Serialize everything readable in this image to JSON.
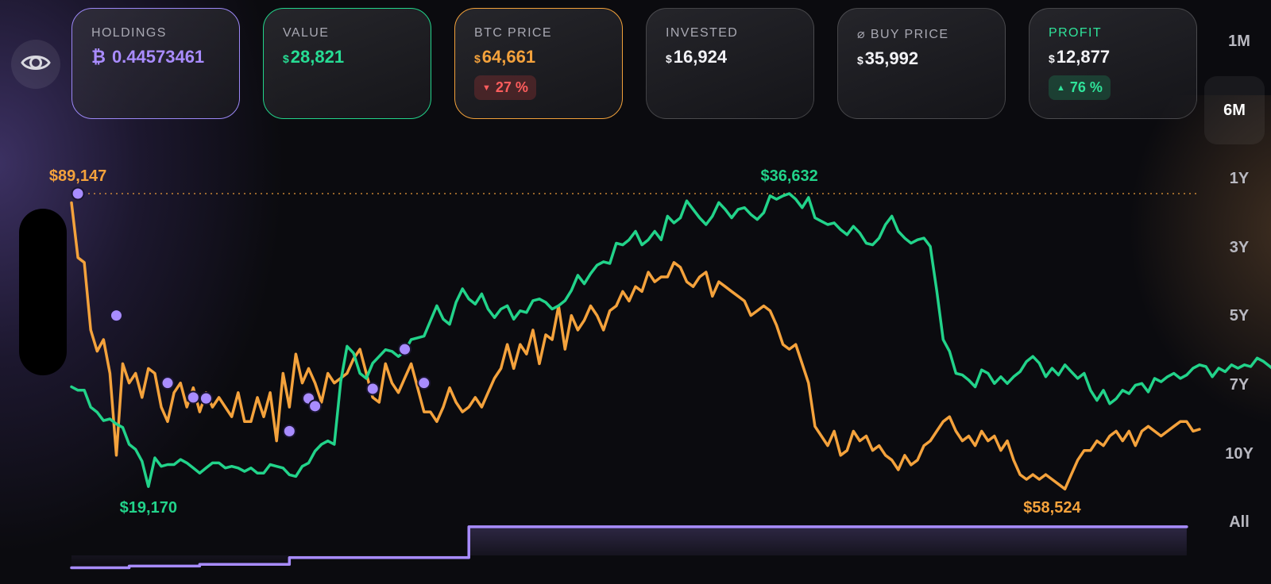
{
  "cards": [
    {
      "label": "HOLDINGS",
      "prefix": "₿",
      "value": "0.44573461",
      "border": "#9b87f5",
      "label_color": "#a8a8b2",
      "value_color": "#a98cff",
      "badge": null
    },
    {
      "label": "VALUE",
      "prefix": "$",
      "value": "28,821",
      "border": "#22d38a",
      "label_color": "#a8a8b2",
      "value_color": "#27dc94",
      "badge": null
    },
    {
      "label": "BTC PRICE",
      "prefix": "$",
      "value": "64,661",
      "border": "#f0a03a",
      "label_color": "#a8a8b2",
      "value_color": "#f4a23c",
      "badge": {
        "text": "27 %",
        "direction": "down",
        "tone": "red"
      }
    },
    {
      "label": "INVESTED",
      "prefix": "$",
      "value": "16,924",
      "border": "rgba(255,255,255,0.18)",
      "label_color": "#a8a8b2",
      "value_color": "#f2f2f6",
      "badge": null
    },
    {
      "label": "⌀ BUY PRICE",
      "prefix": "$",
      "value": "35,992",
      "border": "rgba(255,255,255,0.18)",
      "label_color": "#a8a8b2",
      "value_color": "#f2f2f6",
      "badge": null
    },
    {
      "label": "PROFIT",
      "prefix": "$",
      "value": "12,877",
      "border": "rgba(255,255,255,0.18)",
      "label_color": "#2fe39a",
      "value_color": "#f2f2f6",
      "badge": {
        "text": "76 %",
        "direction": "up",
        "tone": "green"
      }
    }
  ],
  "ranges": [
    "1M",
    "6M",
    "1Y",
    "3Y",
    "5Y",
    "7Y",
    "10Y",
    "All"
  ],
  "active_range": "6M",
  "icons": {
    "toggle_visibility": "eye-icon"
  },
  "colors": {
    "value": "#22d38a",
    "price": "#f4a23c",
    "invested": "#a88cff",
    "buy": "#a88cff"
  },
  "chart_data": {
    "type": "line",
    "x_count": 177,
    "series": [
      {
        "key": "price",
        "values": [
          88200,
          82500,
          82000,
          75000,
          72800,
          74000,
          70500,
          62000,
          71500,
          69500,
          70500,
          68000,
          71000,
          70500,
          67000,
          65500,
          68500,
          69500,
          67000,
          69000,
          66500,
          68500,
          67000,
          68000,
          67000,
          66000,
          68500,
          65500,
          65500,
          68000,
          66000,
          68500,
          63500,
          70500,
          67000,
          72500,
          69500,
          71000,
          69500,
          67500,
          70500,
          69500,
          70000,
          70500,
          72000,
          73000,
          70500,
          68000,
          67500,
          71500,
          69500,
          68500,
          70000,
          71500,
          69000,
          66500,
          66500,
          65500,
          67000,
          69000,
          67500,
          66500,
          67000,
          68000,
          67000,
          68500,
          70000,
          71000,
          73500,
          71000,
          73500,
          72500,
          75000,
          71500,
          74500,
          74000,
          77500,
          73000,
          76500,
          75000,
          76000,
          77500,
          76500,
          75000,
          77000,
          77500,
          79000,
          78000,
          79500,
          79000,
          81000,
          80000,
          80500,
          80500,
          82000,
          81500,
          80000,
          79500,
          80500,
          81000,
          78500,
          80000,
          79500,
          79000,
          78500,
          78000,
          76500,
          77000,
          77500,
          77000,
          75500,
          73500,
          73000,
          73500,
          71500,
          69500,
          65000,
          64000,
          63000,
          64500,
          62000,
          62500,
          64500,
          63500,
          64000,
          62500,
          63000,
          62000,
          61500,
          60500,
          62000,
          61000,
          61500,
          63000,
          63500,
          64500,
          65500,
          66000,
          64500,
          63500,
          64000,
          63000,
          64500,
          63500,
          64000,
          62500,
          63500,
          61500,
          60000,
          59500,
          60000,
          59500,
          60000,
          59500,
          59000,
          58500,
          60000,
          61500,
          62500,
          62500,
          63500,
          63000,
          64000,
          64500,
          63500,
          64500,
          63000,
          64500,
          65000,
          64500,
          64000,
          64500,
          65000,
          65500,
          65500,
          64500,
          64700
        ]
      },
      {
        "key": "value",
        "values": [
          25200,
          25000,
          25000,
          24000,
          23700,
          23200,
          23300,
          23000,
          22800,
          21800,
          21500,
          20800,
          19300,
          21000,
          20500,
          20600,
          20600,
          20900,
          20700,
          20400,
          20100,
          20400,
          20700,
          20700,
          20400,
          20500,
          20400,
          20200,
          20400,
          20100,
          20100,
          20600,
          20500,
          20400,
          20000,
          19900,
          20500,
          20700,
          21400,
          21800,
          22000,
          21800,
          25500,
          27600,
          27200,
          26000,
          25700,
          26600,
          27000,
          27400,
          27300,
          27000,
          27300,
          28000,
          28100,
          28200,
          29100,
          30000,
          29200,
          28900,
          30200,
          31000,
          30400,
          30100,
          30700,
          29800,
          29300,
          29800,
          30000,
          29200,
          29700,
          29600,
          30300,
          30400,
          30200,
          29800,
          30000,
          30300,
          30900,
          31800,
          31300,
          31900,
          32400,
          32600,
          32500,
          33700,
          33600,
          33900,
          34400,
          33600,
          33900,
          34400,
          33900,
          35300,
          34900,
          35200,
          36200,
          35700,
          35200,
          34800,
          35300,
          36100,
          35700,
          35200,
          35700,
          35800,
          35400,
          35100,
          35500,
          36500,
          36300,
          36500,
          36632,
          36300,
          35800,
          36400,
          35200,
          35000,
          34800,
          34900,
          34500,
          34200,
          34700,
          34300,
          33700,
          33600,
          34000,
          34800,
          35300,
          34400,
          34000,
          33700,
          33900,
          34000,
          33500,
          30900,
          28000,
          27300,
          26000,
          25900,
          25600,
          25200,
          26200,
          26000,
          25400,
          25800,
          25400,
          25800,
          26100,
          26700,
          27000,
          26600,
          25800,
          26300,
          25900,
          26500,
          26100,
          25700,
          26000,
          25000,
          24400,
          25000,
          24200,
          24500,
          25000,
          24800,
          25300,
          25400,
          24900,
          25700,
          25500,
          25800,
          26000,
          25700,
          25900,
          26300,
          26500,
          26400,
          25800,
          26300,
          26100,
          26500,
          26300,
          26500,
          26400,
          26900,
          26700,
          26400,
          26100
        ]
      },
      {
        "key": "invested",
        "values": [
          14500,
          14500,
          14500,
          14500,
          14500,
          14500,
          14500,
          14500,
          14500,
          14600,
          14600,
          14600,
          14600,
          14600,
          14600,
          14600,
          14600,
          14600,
          14600,
          14600,
          14700,
          14700,
          14700,
          14700,
          14700,
          14700,
          14700,
          14700,
          14700,
          14700,
          14700,
          14700,
          14700,
          14700,
          15100,
          15100,
          15100,
          15100,
          15100,
          15100,
          15100,
          15100,
          15100,
          15100,
          15100,
          15100,
          15100,
          15100,
          15100,
          15100,
          15100,
          15100,
          15100,
          15100,
          15100,
          15100,
          15100,
          15100,
          15100,
          15100,
          15100,
          15100,
          16924,
          16924,
          16924,
          16924,
          16924,
          16924,
          16924,
          16924,
          16924,
          16924,
          16924,
          16924,
          16924,
          16924,
          16924,
          16924,
          16924,
          16924,
          16924,
          16924,
          16924,
          16924,
          16924,
          16924,
          16924,
          16924,
          16924,
          16924,
          16924,
          16924,
          16924,
          16924,
          16924,
          16924,
          16924,
          16924,
          16924,
          16924,
          16924,
          16924,
          16924,
          16924,
          16924,
          16924,
          16924,
          16924,
          16924,
          16924,
          16924,
          16924,
          16924,
          16924,
          16924,
          16924,
          16924,
          16924,
          16924,
          16924,
          16924,
          16924,
          16924,
          16924,
          16924,
          16924,
          16924,
          16924,
          16924,
          16924,
          16924,
          16924,
          16924,
          16924,
          16924,
          16924,
          16924,
          16924,
          16924,
          16924,
          16924,
          16924,
          16924,
          16924,
          16924,
          16924,
          16924,
          16924,
          16924,
          16924,
          16924,
          16924,
          16924,
          16924,
          16924,
          16924,
          16924,
          16924,
          16924,
          16924,
          16924,
          16924,
          16924,
          16924,
          16924,
          16924,
          16924,
          16924,
          16924,
          16924,
          16924,
          16924,
          16924,
          16924,
          16924
        ]
      }
    ],
    "buy_points": [
      {
        "i": 1,
        "price": 89147
      },
      {
        "i": 7,
        "price": 76500
      },
      {
        "i": 15,
        "price": 69500
      },
      {
        "i": 19,
        "price": 68000
      },
      {
        "i": 21,
        "price": 67900
      },
      {
        "i": 34,
        "price": 64500
      },
      {
        "i": 37,
        "price": 67900
      },
      {
        "i": 38,
        "price": 67100
      },
      {
        "i": 47,
        "price": 68900
      },
      {
        "i": 52,
        "price": 73000
      },
      {
        "i": 55,
        "price": 69500
      }
    ],
    "annotations": [
      {
        "text": "$89,147",
        "series": "price",
        "i": 1,
        "value": 89147,
        "position": "above"
      },
      {
        "text": "$58,524",
        "series": "price",
        "i": 153,
        "value": 58524,
        "position": "below"
      },
      {
        "text": "$36,632",
        "series": "value",
        "i": 112,
        "value": 36632,
        "position": "above"
      },
      {
        "text": "$19,170",
        "series": "value",
        "i": 12,
        "value": 19170,
        "position": "below"
      }
    ],
    "price_max_line": 89147
  }
}
